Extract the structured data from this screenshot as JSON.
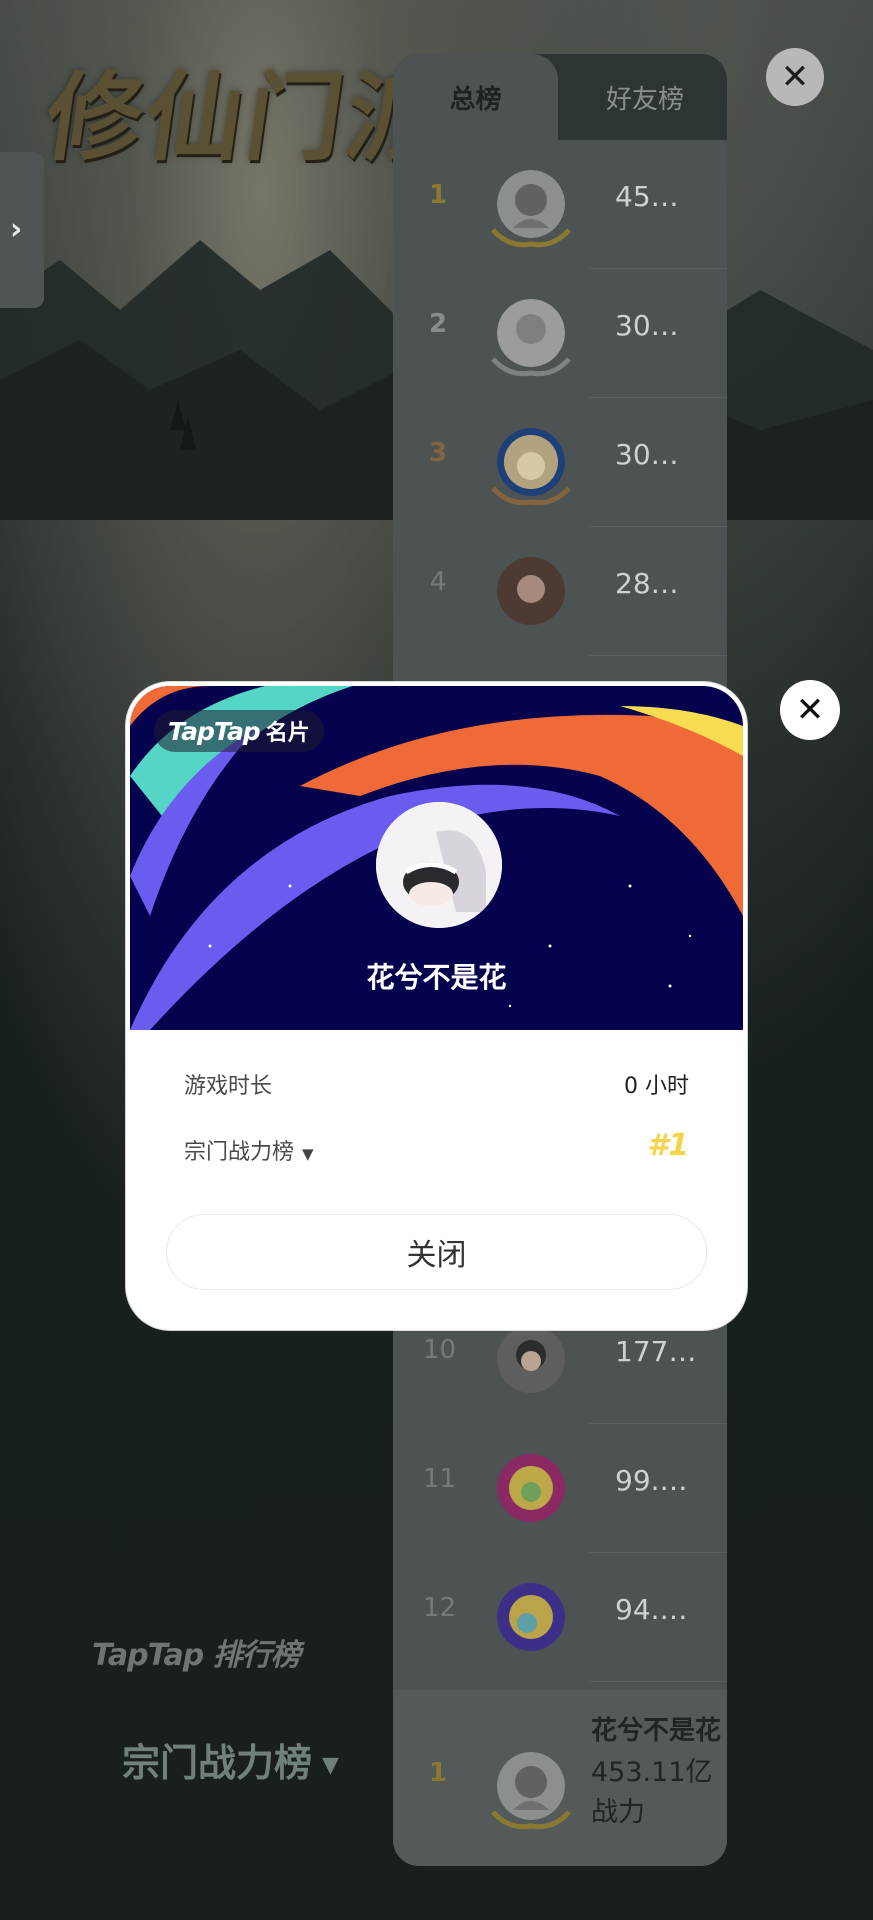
{
  "game": {
    "title": "修仙门派"
  },
  "side_tab": {
    "icon": "chevron-right-icon",
    "glyph": "›"
  },
  "top_close": {
    "glyph": "✕"
  },
  "leaderboard": {
    "tabs": [
      "总榜",
      "好友榜"
    ],
    "rows": [
      {
        "rank": "1",
        "score": "45…",
        "tier": "gold"
      },
      {
        "rank": "2",
        "score": "30…",
        "tier": "silver"
      },
      {
        "rank": "3",
        "score": "30…",
        "tier": "bronze"
      },
      {
        "rank": "4",
        "score": "28…",
        "tier": ""
      }
    ],
    "rows_bottom": [
      {
        "rank": "10",
        "score": "177…"
      },
      {
        "rank": "11",
        "score": "99.…"
      },
      {
        "rank": "12",
        "score": "94.…"
      }
    ],
    "me": {
      "rank": "1",
      "name": "花兮不是花",
      "score": "453.11亿",
      "unit": "战力"
    }
  },
  "footer": {
    "brand": "TapTap 排行榜",
    "board": "宗门战力榜",
    "arrow": "▼"
  },
  "card": {
    "badge_brand": "TapTap",
    "badge_label": "名片",
    "name": "花兮不是花",
    "play_time_label": "游戏时长",
    "play_time_value": "0 小时",
    "board_label": "宗门战力榜",
    "board_rank": "#1",
    "close_label": "关闭",
    "close_glyph": "✕"
  },
  "colors": {
    "banner_bg": "#05034d",
    "purple": "#6b5cf0",
    "orange": "#f06a38",
    "teal": "#55d5c5",
    "yellow": "#f7dc52",
    "gold": "#f5d44a"
  }
}
